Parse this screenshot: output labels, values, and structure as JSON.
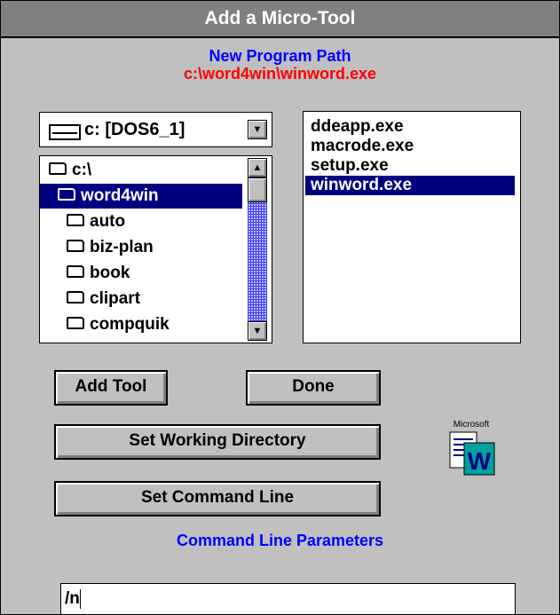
{
  "window": {
    "title": "Add a Micro-Tool"
  },
  "program_path": {
    "heading": "New Program Path",
    "value": "c:\\word4win\\winword.exe"
  },
  "drive": {
    "selected": "c: [DOS6_1]"
  },
  "directories": [
    {
      "name": "c:\\",
      "icon": "open-folder-icon",
      "selected": false
    },
    {
      "name": "word4win",
      "icon": "open-folder-icon",
      "selected": true
    },
    {
      "name": "auto",
      "icon": "folder-icon",
      "selected": false
    },
    {
      "name": "biz-plan",
      "icon": "folder-icon",
      "selected": false
    },
    {
      "name": "book",
      "icon": "folder-icon",
      "selected": false
    },
    {
      "name": "clipart",
      "icon": "folder-icon",
      "selected": false
    },
    {
      "name": "compquik",
      "icon": "folder-icon",
      "selected": false
    }
  ],
  "files": [
    {
      "name": "ddeapp.exe",
      "selected": false
    },
    {
      "name": "macrode.exe",
      "selected": false
    },
    {
      "name": "setup.exe",
      "selected": false
    },
    {
      "name": "winword.exe",
      "selected": true
    }
  ],
  "buttons": {
    "add_tool": "Add Tool",
    "done": "Done",
    "set_working_directory": "Set Working Directory",
    "set_command_line": "Set Command Line"
  },
  "command_line": {
    "label": "Command Line Parameters",
    "value": "/n"
  },
  "logo": {
    "text": "Microsoft",
    "letter": "W"
  },
  "colors": {
    "title_bar": "#808080",
    "heading_blue": "#0000ff",
    "path_red": "#ff0000",
    "selection": "#000080",
    "dialog_bg": "#c0c0c0"
  }
}
